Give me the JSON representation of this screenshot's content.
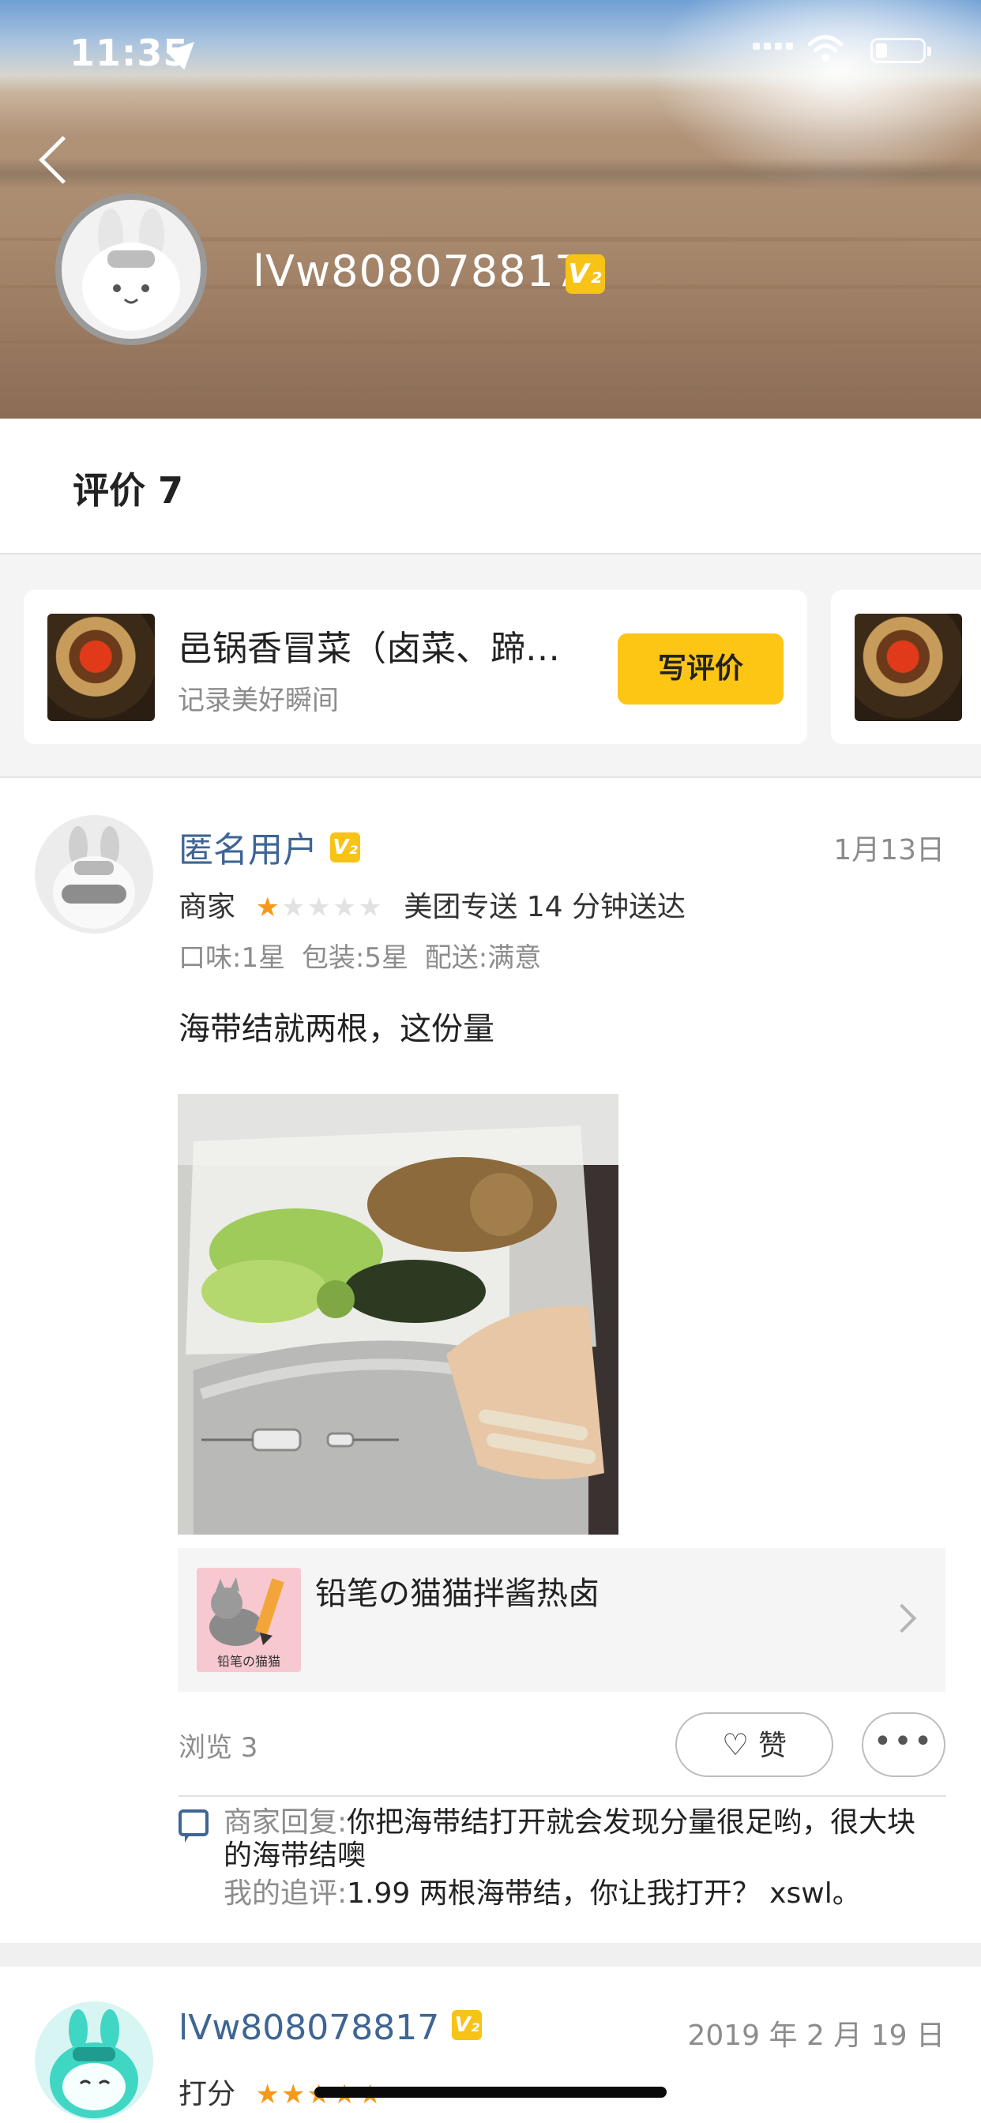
{
  "status_bar": {
    "time": "11:35"
  },
  "profile": {
    "username": "lVw808078817",
    "level_badge": "V₂"
  },
  "tabs": [
    {
      "label": "评价 7"
    }
  ],
  "write_review": {
    "items": [
      {
        "title": "邑锅香冒菜（卤菜、蹄…",
        "subtitle": "记录美好瞬间",
        "button_label": "写评价"
      }
    ]
  },
  "reviews": [
    {
      "user": "匿名用户",
      "badge": "V₂",
      "date": "1月13日",
      "merchant_label": "商家",
      "merchant_stars": 1,
      "delivery": "美团专送 14 分钟送达",
      "ratings": "口味:1星  包装:5星  配送:满意",
      "text": "海带结就两根，这份量",
      "shop_name": "铅笔の猫猫拌酱热卤",
      "shop_logo_text": "铅笔の猫猫",
      "views": "浏览 3",
      "like_label": "赞",
      "merchant_reply_label": "商家回复:",
      "merchant_reply": "你把海带结打开就会发现分量很足哟，很大块的海带结噢",
      "followup_label": "我的追评:",
      "followup": "1.99 两根海带结，你让我打开？   xswl。"
    },
    {
      "user": "lVw808078817",
      "badge": "V₂",
      "date": "2019 年 2 月 19 日",
      "score_label": "打分",
      "score_stars": 5
    }
  ],
  "colors": {
    "accent": "#fdc514",
    "link": "#3e6594",
    "star": "#f49a1a"
  }
}
